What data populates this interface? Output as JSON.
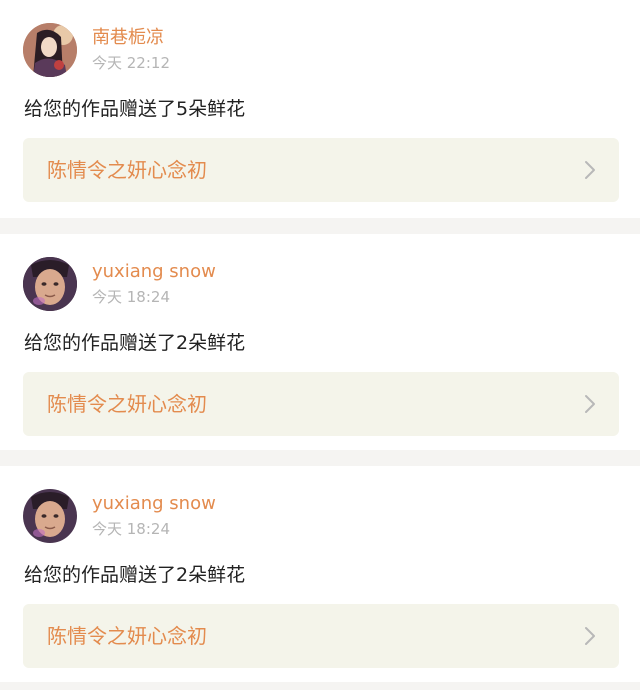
{
  "notifications": [
    {
      "username": "南巷栀凉",
      "time": "今天 22:12",
      "message": "给您的作品赠送了5朵鲜花",
      "work_title": "陈情令之妍心念初",
      "avatar_style": "anime-girl"
    },
    {
      "username": "yuxiang snow",
      "time": "今天 18:24",
      "message": "给您的作品赠送了2朵鲜花",
      "work_title": "陈情令之妍心念初",
      "avatar_style": "person-photo"
    },
    {
      "username": "yuxiang snow",
      "time": "今天 18:24",
      "message": "给您的作品赠送了2朵鲜花",
      "work_title": "陈情令之妍心念初",
      "avatar_style": "person-photo"
    }
  ],
  "colors": {
    "accent": "#e38b4e",
    "timestamp": "#b5b5b5",
    "link_bg": "#f4f4ea",
    "separator": "#f5f4f2"
  },
  "icons": {
    "chevron": "chevron-right-icon"
  }
}
